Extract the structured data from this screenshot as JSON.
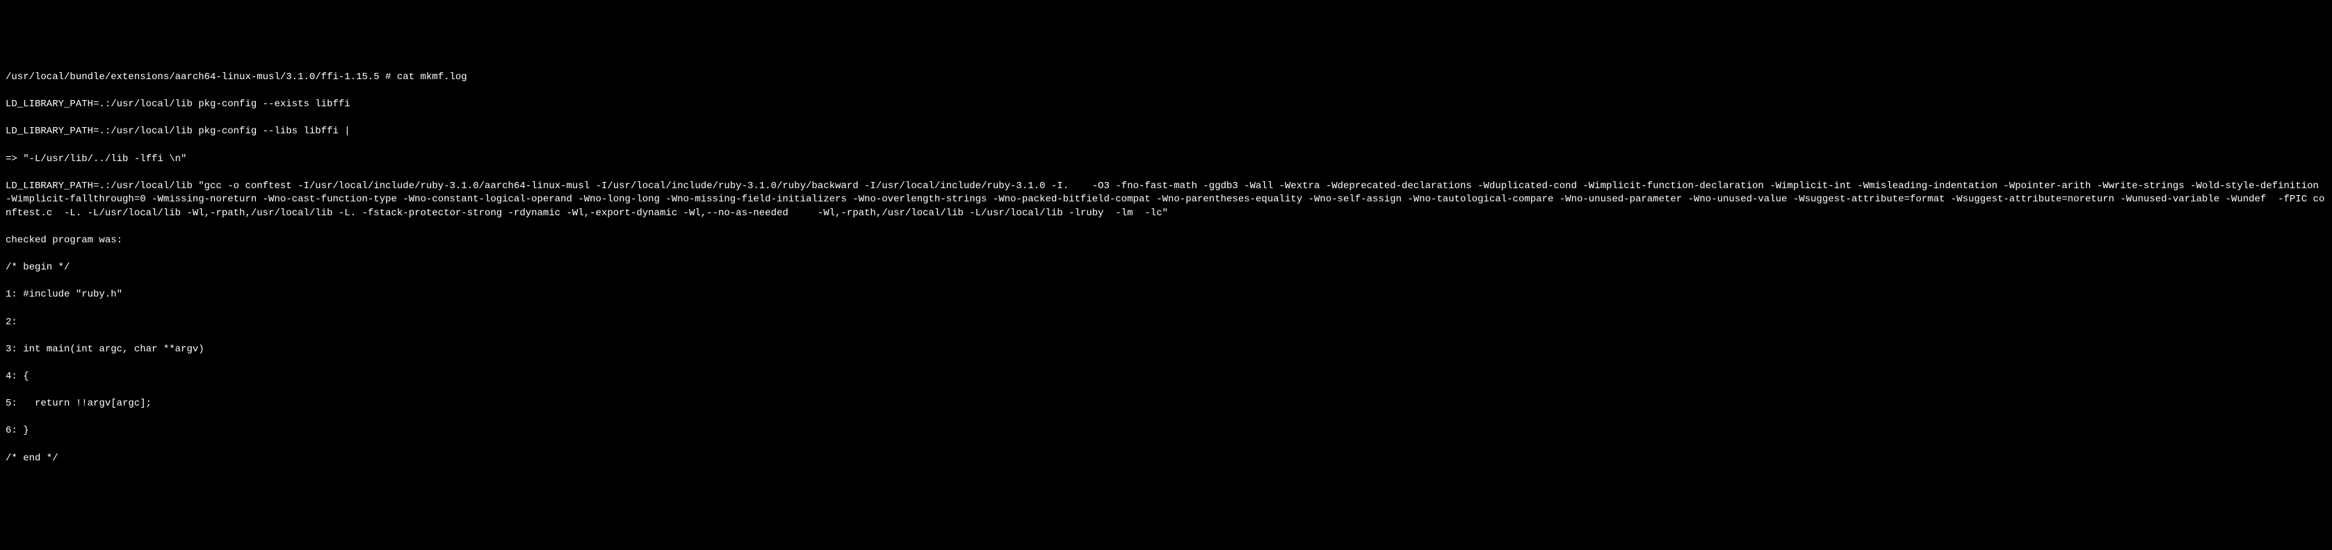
{
  "terminal": {
    "lines": [
      "/usr/local/bundle/extensions/aarch64-linux-musl/3.1.0/ffi-1.15.5 # cat mkmf.log",
      "LD_LIBRARY_PATH=.:/usr/local/lib pkg-config --exists libffi",
      "LD_LIBRARY_PATH=.:/usr/local/lib pkg-config --libs libffi |",
      "=> \"-L/usr/lib/../lib -lffi \\n\"",
      "LD_LIBRARY_PATH=.:/usr/local/lib \"gcc -o conftest -I/usr/local/include/ruby-3.1.0/aarch64-linux-musl -I/usr/local/include/ruby-3.1.0/ruby/backward -I/usr/local/include/ruby-3.1.0 -I.    -O3 -fno-fast-math -ggdb3 -Wall -Wextra -Wdeprecated-declarations -Wduplicated-cond -Wimplicit-function-declaration -Wimplicit-int -Wmisleading-indentation -Wpointer-arith -Wwrite-strings -Wold-style-definition -Wimplicit-fallthrough=0 -Wmissing-noreturn -Wno-cast-function-type -Wno-constant-logical-operand -Wno-long-long -Wno-missing-field-initializers -Wno-overlength-strings -Wno-packed-bitfield-compat -Wno-parentheses-equality -Wno-self-assign -Wno-tautological-compare -Wno-unused-parameter -Wno-unused-value -Wsuggest-attribute=format -Wsuggest-attribute=noreturn -Wunused-variable -Wundef  -fPIC conftest.c  -L. -L/usr/local/lib -Wl,-rpath,/usr/local/lib -L. -fstack-protector-strong -rdynamic -Wl,-export-dynamic -Wl,--no-as-needed     -Wl,-rpath,/usr/local/lib -L/usr/local/lib -lruby  -lm  -lc\"",
      "checked program was:",
      "/* begin */",
      "1: #include \"ruby.h\"",
      "2:",
      "3: int main(int argc, char **argv)",
      "4: {",
      "5:   return !!argv[argc];",
      "6: }",
      "/* end */"
    ]
  }
}
